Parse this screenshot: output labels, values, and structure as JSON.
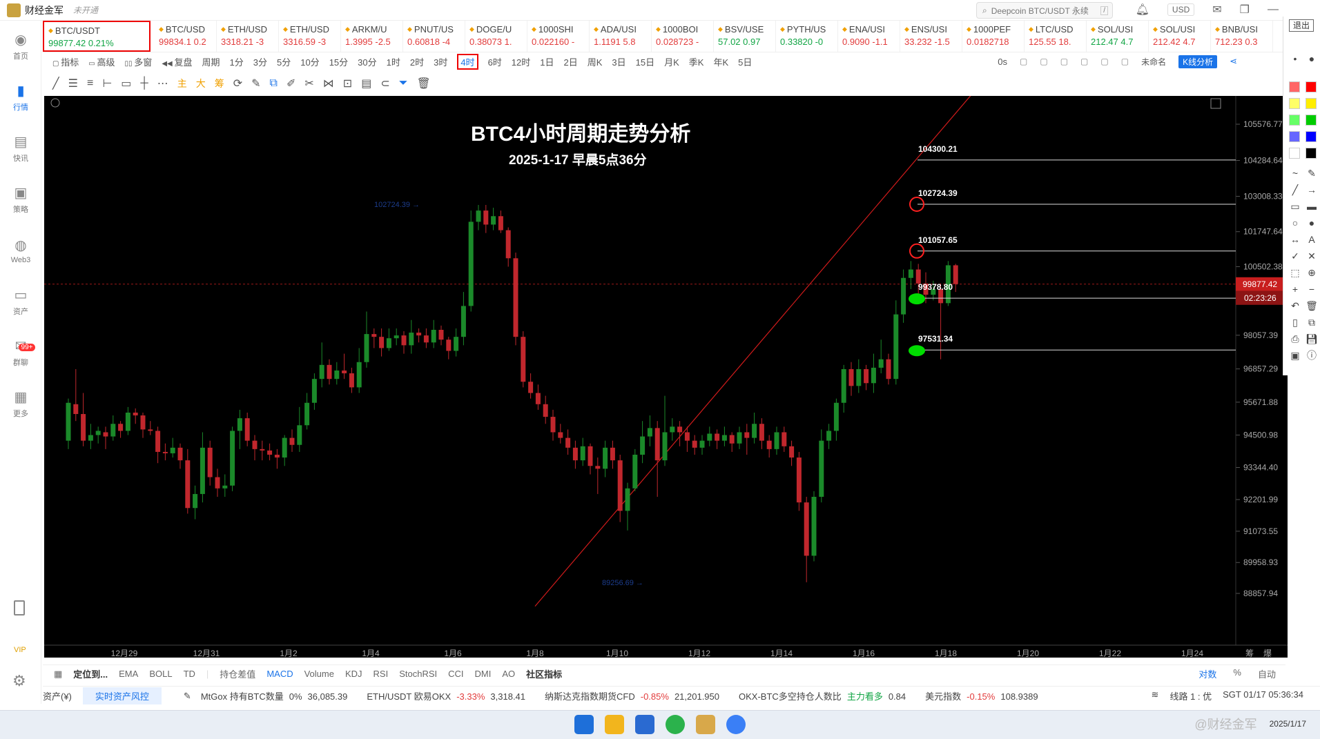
{
  "app": {
    "title": "财经金军",
    "status": "未开通",
    "search_placeholder": "Deepcoin BTC/USDT 永续",
    "search_shortcut": "/",
    "currency": "USD"
  },
  "leftnav": [
    {
      "label": "首页",
      "icon": "globe-icon",
      "glyph": "◉"
    },
    {
      "label": "行情",
      "icon": "bar-chart-icon",
      "glyph": "▮",
      "active": true
    },
    {
      "label": "快讯",
      "icon": "news-icon",
      "glyph": "▤"
    },
    {
      "label": "策略",
      "icon": "strategy-icon",
      "glyph": "▣"
    },
    {
      "label": "Web3",
      "icon": "web3-icon",
      "glyph": "◍"
    },
    {
      "label": "资产",
      "icon": "wallet-icon",
      "glyph": "▭"
    },
    {
      "label": "群聊",
      "icon": "chat-icon",
      "glyph": "✉",
      "badge": "99+"
    },
    {
      "label": "更多",
      "icon": "grid-icon",
      "glyph": "▦"
    }
  ],
  "leftnav_bottom": {
    "vip": "VIP"
  },
  "tickers": [
    {
      "name": "BTC/USDT",
      "price": "99877.42  0.21%",
      "dir": "up"
    },
    {
      "name": "BTC/USD",
      "price": "99834.1  0.2",
      "dir": "dn"
    },
    {
      "name": "ETH/USD",
      "price": "3318.21  -3",
      "dir": "dn"
    },
    {
      "name": "ETH/USD",
      "price": "3316.59  -3",
      "dir": "dn"
    },
    {
      "name": "ARKM/U",
      "price": "1.3995  -2.5",
      "dir": "dn"
    },
    {
      "name": "PNUT/US",
      "price": "0.60818  -4",
      "dir": "dn"
    },
    {
      "name": "DOGE/U",
      "price": "0.38073  1.",
      "dir": "dn"
    },
    {
      "name": "1000SHI",
      "price": "0.022160  -",
      "dir": "dn"
    },
    {
      "name": "ADA/USI",
      "price": "1.1191  5.8",
      "dir": "dn"
    },
    {
      "name": "1000BOI",
      "price": "0.028723  -",
      "dir": "dn"
    },
    {
      "name": "BSV/USE",
      "price": "57.02  0.97",
      "dir": "up"
    },
    {
      "name": "PYTH/US",
      "price": "0.33820  -0",
      "dir": "up"
    },
    {
      "name": "ENA/USI",
      "price": "0.9090  -1.1",
      "dir": "dn"
    },
    {
      "name": "ENS/USI",
      "price": "33.232  -1.5",
      "dir": "dn"
    },
    {
      "name": "1000PEF",
      "price": "0.0182718",
      "dir": "dn"
    },
    {
      "name": "LTC/USD",
      "price": "125.55  18.",
      "dir": "dn"
    },
    {
      "name": "SOL/USI",
      "price": "212.47  4.7",
      "dir": "up"
    },
    {
      "name": "SOL/USI",
      "price": "212.42  4.7",
      "dir": "dn"
    },
    {
      "name": "BNB/USI",
      "price": "712.23  0.3",
      "dir": "dn"
    }
  ],
  "interval_bar": {
    "tools": [
      "指标",
      "高级",
      "多窗",
      "复盘"
    ],
    "period_label": "周期",
    "intervals": [
      "1分",
      "3分",
      "5分",
      "10分",
      "15分",
      "30分",
      "1时",
      "2时",
      "3时",
      "4时",
      "6时",
      "12时",
      "1日",
      "2日",
      "周K",
      "3日",
      "15日",
      "月K",
      "季K",
      "年K",
      "5日"
    ],
    "selected": "4时",
    "right": {
      "delay": "0s",
      "unnamed": "未命名",
      "kline_btn": "K线分析"
    }
  },
  "draw_bar": {
    "cn_tools": [
      "主",
      "大",
      "筹"
    ]
  },
  "chart_data": {
    "type": "candlestick",
    "title": "BTC4小时周期走势分析",
    "subtitle": "2025-1-17   早晨5点36分",
    "y_ticks": [
      105576.77,
      104284.64,
      103008.33,
      101747.64,
      100502.38,
      98057.39,
      96857.29,
      95671.88,
      94500.98,
      93344.4,
      92201.99,
      91073.55,
      89958.93,
      88857.94
    ],
    "ylim": [
      88000,
      107000
    ],
    "x_ticks": [
      "12月29",
      "12月31",
      "1月2",
      "1月4",
      "1月6",
      "1月8",
      "1月10",
      "1月12",
      "1月14",
      "1月16",
      "1月18",
      "1月20",
      "1月22",
      "1月24"
    ],
    "x_right_labels": [
      "筹",
      "爆"
    ],
    "last_price": "99877.42",
    "countdown": "02:23:26",
    "high_marker": "102724.39",
    "low_marker": "89256.69",
    "levels": [
      {
        "value": 104300.21,
        "label": "104300.21",
        "marker": "none"
      },
      {
        "value": 102724.39,
        "label": "102724.39",
        "marker": "red-circle"
      },
      {
        "value": 101057.65,
        "label": "101057.65",
        "marker": "red-circle"
      },
      {
        "value": 99378.8,
        "label": "99378.80",
        "marker": "green-dot"
      },
      {
        "value": 97531.34,
        "label": "97531.34",
        "marker": "green-dot"
      }
    ],
    "trendline": {
      "from": {
        "x": "1月8",
        "y": 88400
      },
      "to": {
        "x": "1月18",
        "y": 107000
      }
    },
    "candles": [
      [
        94300,
        95650,
        95800,
        94000
      ],
      [
        95600,
        95250,
        96850,
        95000
      ],
      [
        95250,
        94300,
        96000,
        94100
      ],
      [
        94300,
        94500,
        94900,
        94000
      ],
      [
        94500,
        94650,
        94800,
        94200
      ],
      [
        94600,
        94450,
        94800,
        94000
      ],
      [
        94450,
        94900,
        95200,
        94300
      ],
      [
        94900,
        94650,
        95000,
        94400
      ],
      [
        94650,
        95300,
        95500,
        94500
      ],
      [
        95300,
        95200,
        95450,
        94900
      ],
      [
        95200,
        94700,
        95300,
        94400
      ],
      [
        94700,
        94650,
        95000,
        94500
      ],
      [
        94650,
        93900,
        94800,
        93500
      ],
      [
        93900,
        93850,
        94200,
        93600
      ],
      [
        93850,
        94050,
        94400,
        93700
      ],
      [
        94050,
        93600,
        94200,
        93300
      ],
      [
        93600,
        91900,
        94000,
        91700
      ],
      [
        91900,
        92400,
        92700,
        91500
      ],
      [
        92400,
        94050,
        94600,
        92100
      ],
      [
        94050,
        93000,
        94300,
        92700
      ],
      [
        93000,
        92600,
        93300,
        92300
      ],
      [
        92600,
        92700,
        93100,
        92300
      ],
      [
        92700,
        94650,
        94800,
        92500
      ],
      [
        94650,
        95100,
        95400,
        94000
      ],
      [
        95100,
        94300,
        95300,
        94100
      ],
      [
        94300,
        94000,
        94500,
        93600
      ],
      [
        94000,
        93950,
        94300,
        93600
      ],
      [
        93950,
        93800,
        94200,
        93600
      ],
      [
        93800,
        93700,
        94000,
        93300
      ],
      [
        93700,
        94400,
        94500,
        93400
      ],
      [
        94400,
        94150,
        94700,
        93900
      ],
      [
        94150,
        94850,
        95500,
        93900
      ],
      [
        94850,
        95650,
        96000,
        94700
      ],
      [
        95650,
        96500,
        96700,
        95400
      ],
      [
        96500,
        97000,
        97800,
        96200
      ],
      [
        97000,
        96500,
        97200,
        96300
      ],
      [
        96500,
        96800,
        97100,
        96300
      ],
      [
        96800,
        96700,
        97400,
        96500
      ],
      [
        96700,
        96200,
        96900,
        96000
      ],
      [
        96200,
        97100,
        97600,
        96000
      ],
      [
        97100,
        98100,
        98900,
        96900
      ],
      [
        98100,
        98000,
        98300,
        97600
      ],
      [
        98000,
        97600,
        98300,
        97300
      ],
      [
        97600,
        97950,
        98300,
        97500
      ],
      [
        97950,
        98050,
        98300,
        97700
      ],
      [
        98050,
        97700,
        98200,
        97400
      ],
      [
        97700,
        98150,
        98600,
        97400
      ],
      [
        98150,
        98050,
        98300,
        97800
      ],
      [
        98050,
        97800,
        98300,
        97600
      ],
      [
        97800,
        98250,
        98600,
        97600
      ],
      [
        98250,
        97900,
        98400,
        97700
      ],
      [
        97900,
        97500,
        98000,
        97200
      ],
      [
        97500,
        98000,
        98300,
        97300
      ],
      [
        98000,
        99100,
        99600,
        97700
      ],
      [
        99100,
        102100,
        102500,
        98900
      ],
      [
        102100,
        102500,
        102700,
        101800
      ],
      [
        102500,
        102000,
        102700,
        101700
      ],
      [
        102000,
        102300,
        102600,
        101800
      ],
      [
        102300,
        101800,
        102500,
        101700
      ],
      [
        101800,
        100800,
        101900,
        100500
      ],
      [
        100800,
        98000,
        101000,
        97700
      ],
      [
        98000,
        96400,
        98200,
        96200
      ],
      [
        96400,
        96000,
        96700,
        95800
      ],
      [
        96000,
        95600,
        96300,
        95400
      ],
      [
        95600,
        95150,
        95900,
        94900
      ],
      [
        95150,
        94600,
        95400,
        94300
      ],
      [
        94600,
        94400,
        94900,
        94200
      ],
      [
        94400,
        94050,
        94700,
        93800
      ],
      [
        94050,
        93600,
        94300,
        93300
      ],
      [
        93600,
        94100,
        94400,
        93400
      ],
      [
        94100,
        93400,
        94200,
        93100
      ],
      [
        93400,
        93300,
        93700,
        92400
      ],
      [
        93300,
        94050,
        94300,
        93000
      ],
      [
        94050,
        93600,
        94300,
        93300
      ],
      [
        93600,
        91800,
        93800,
        91400
      ],
      [
        91800,
        92600,
        92800,
        91100
      ],
      [
        92600,
        93800,
        94000,
        92500
      ],
      [
        93800,
        94450,
        95000,
        93500
      ],
      [
        94450,
        94750,
        95200,
        94100
      ],
      [
        94750,
        93600,
        95000,
        92300
      ],
      [
        93600,
        94600,
        95900,
        93400
      ],
      [
        94600,
        94800,
        95100,
        94300
      ],
      [
        94800,
        94600,
        95000,
        94100
      ],
      [
        94600,
        94300,
        94800,
        93900
      ],
      [
        94300,
        94050,
        94500,
        93800
      ],
      [
        94050,
        94300,
        94500,
        93800
      ],
      [
        94300,
        94550,
        94800,
        94100
      ],
      [
        94550,
        94300,
        94700,
        94000
      ],
      [
        94300,
        94500,
        94800,
        94100
      ],
      [
        94500,
        94200,
        94600,
        93900
      ],
      [
        94200,
        94600,
        94800,
        94000
      ],
      [
        94600,
        94400,
        94900,
        93800
      ],
      [
        94400,
        94900,
        95300,
        94200
      ],
      [
        94900,
        94300,
        95100,
        94000
      ],
      [
        94300,
        94000,
        94500,
        93700
      ],
      [
        94000,
        94600,
        94800,
        93800
      ],
      [
        94600,
        94100,
        94800,
        93900
      ],
      [
        94100,
        93700,
        94300,
        93400
      ],
      [
        93700,
        92100,
        93900,
        91800
      ],
      [
        92100,
        90200,
        92300,
        89256
      ],
      [
        90200,
        92300,
        92500,
        90000
      ],
      [
        92300,
        94300,
        94700,
        92100
      ],
      [
        94300,
        94650,
        94900,
        94000
      ],
      [
        94650,
        95650,
        95800,
        94300
      ],
      [
        95650,
        96850,
        97000,
        95300
      ],
      [
        96850,
        96250,
        97100,
        95900
      ],
      [
        96250,
        96850,
        97200,
        96000
      ],
      [
        96850,
        96350,
        97000,
        96100
      ],
      [
        96350,
        96900,
        97400,
        96000
      ],
      [
        96900,
        97200,
        97900,
        96700
      ],
      [
        97200,
        96500,
        97400,
        96300
      ],
      [
        96500,
        98800,
        99300,
        96300
      ],
      [
        98800,
        100100,
        100400,
        98500
      ],
      [
        100100,
        100400,
        100700,
        99700
      ],
      [
        100400,
        99900,
        100600,
        99500
      ],
      [
        99900,
        99500,
        100300,
        99200
      ],
      [
        99500,
        99700,
        100000,
        99300
      ],
      [
        99700,
        99200,
        99900,
        97200
      ],
      [
        99200,
        100550,
        100700,
        99100
      ],
      [
        100550,
        99880,
        100600,
        99600
      ]
    ]
  },
  "indicator_bar": {
    "locate": "定位到...",
    "indicators": [
      "EMA",
      "BOLL",
      "TD"
    ],
    "subs": [
      "持仓差值",
      "MACD",
      "Volume",
      "KDJ",
      "RSI",
      "StochRSI",
      "CCI",
      "DMI",
      "AO"
    ],
    "active": "MACD",
    "community": "社区指标",
    "right": [
      "对数",
      "%",
      "自动"
    ]
  },
  "status_bar": {
    "assets": "资产(¥)",
    "risk": "实时资产风控",
    "items": [
      {
        "label": "MtGox 持有BTC数量",
        "change": "0%",
        "value": "36,085.39",
        "cls": ""
      },
      {
        "label": "ETH/USDT 欧易OKX",
        "change": "-3.33%",
        "value": "3,318.41",
        "cls": "red"
      },
      {
        "label": "纳斯达克指数期货CFD",
        "change": "-0.85%",
        "value": "21,201.950",
        "cls": "red"
      },
      {
        "label": "OKX-BTC多空持仓人数比",
        "change": "主力看多",
        "value": "0.84",
        "cls": "green"
      },
      {
        "label": "美元指数",
        "change": "-0.15%",
        "value": "108.9389",
        "cls": "red"
      }
    ],
    "line": "线路 1 : 优",
    "time": "SGT 01/17 05:36:34"
  },
  "palette": {
    "exit": "退出",
    "colors": [
      "#ff6666",
      "#ff0000",
      "#ffff66",
      "#ffee00",
      "#66ff66",
      "#00cc00",
      "#6666ff",
      "#0000ff",
      "#ffffff",
      "#000000"
    ]
  },
  "taskbar": {
    "watermark": "@财经金军",
    "date": "2025/1/17"
  },
  "colors": {
    "up": "#11a544",
    "down": "#e23b3b",
    "candle_up": "#1b8a2a",
    "candle_down": "#c1272d",
    "accent": "#1a73e8"
  }
}
